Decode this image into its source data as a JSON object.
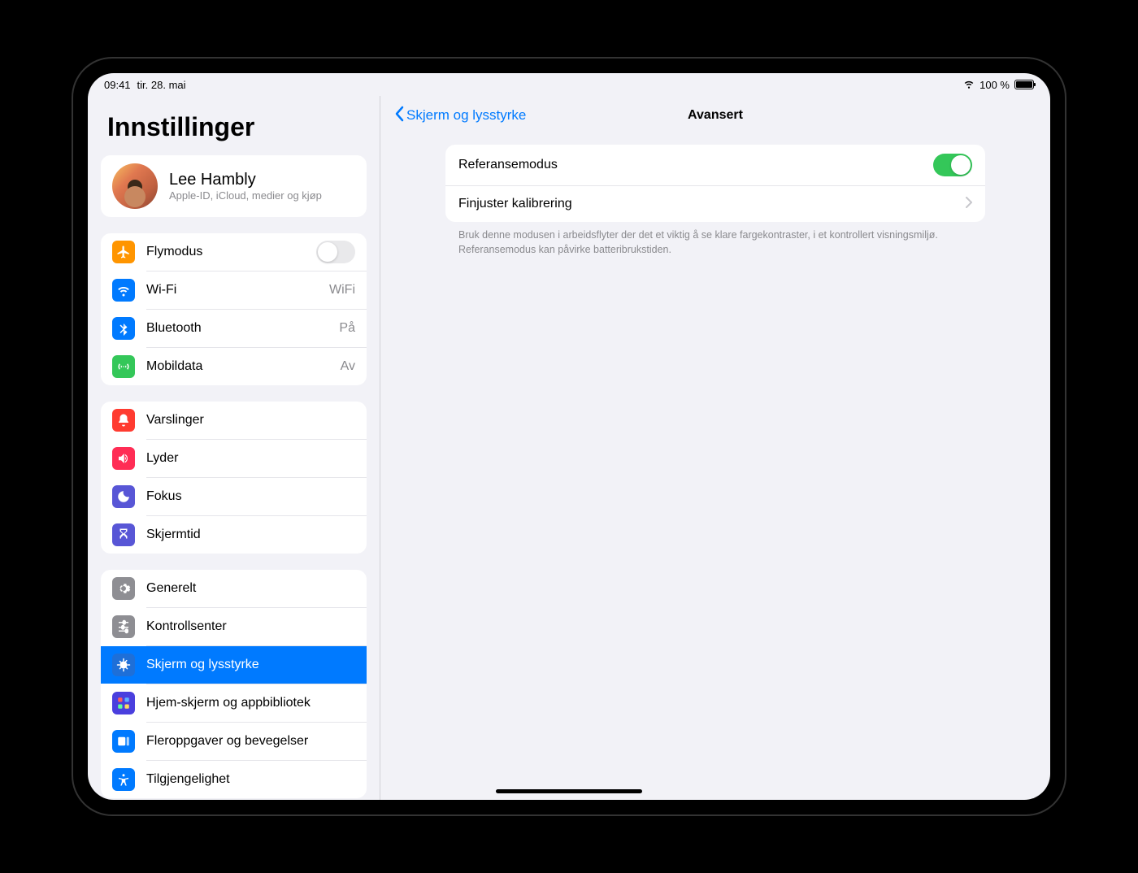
{
  "status": {
    "time": "09:41",
    "date": "tir. 28. mai",
    "battery_pct": "100 %"
  },
  "sidebar": {
    "title": "Innstillinger",
    "profile": {
      "name": "Lee Hambly",
      "sub": "Apple-ID, iCloud, medier og kjøp"
    },
    "conn": {
      "airplane": "Flymodus",
      "wifi": "Wi-Fi",
      "wifi_val": "WiFi",
      "bt": "Bluetooth",
      "bt_val": "På",
      "cell": "Mobildata",
      "cell_val": "Av"
    },
    "notif": {
      "notifications": "Varslinger",
      "sounds": "Lyder",
      "focus": "Fokus",
      "screentime": "Skjermtid"
    },
    "general": {
      "general": "Generelt",
      "control": "Kontrollsenter",
      "display": "Skjerm og lysstyrke",
      "home": "Hjem-skjerm og appbibliotek",
      "multitask": "Fleroppgaver og bevegelser",
      "accessibility": "Tilgjengelighet"
    }
  },
  "detail": {
    "back": "Skjerm og lysstyrke",
    "title": "Avansert",
    "reference_mode": "Referansemodus",
    "fine_tune": "Finjuster kalibrering",
    "footer": "Bruk denne modusen i arbeidsflyter der det et viktig å se klare fargekontraster, i et kontrollert visnings­miljø. Referansemodus kan påvirke batteribrukstiden."
  },
  "colors": {
    "orange": "#ff9500",
    "blue": "#007aff",
    "green": "#34c759",
    "red": "#ff3b30",
    "pink": "#ff2d55",
    "indigo": "#5856d6",
    "gray": "#8e8e93"
  }
}
